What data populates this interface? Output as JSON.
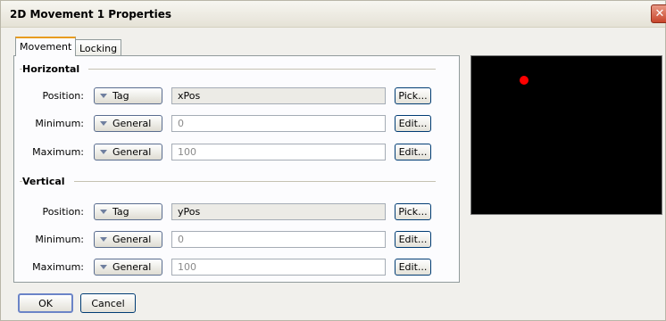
{
  "window": {
    "title": "2D Movement 1 Properties",
    "close_glyph": "✕"
  },
  "tabs": [
    {
      "label": "Movement"
    },
    {
      "label": "Locking"
    }
  ],
  "sections": [
    {
      "label": "Horizontal",
      "rows": [
        {
          "label": "Position:",
          "mode": "Tag",
          "value": "xPos",
          "action": "Pick..."
        },
        {
          "label": "Minimum:",
          "mode": "General",
          "value": "0",
          "action": "Edit..."
        },
        {
          "label": "Maximum:",
          "mode": "General",
          "value": "100",
          "action": "Edit..."
        }
      ]
    },
    {
      "label": "Vertical",
      "rows": [
        {
          "label": "Position:",
          "mode": "Tag",
          "value": "yPos",
          "action": "Pick..."
        },
        {
          "label": "Minimum:",
          "mode": "General",
          "value": "0",
          "action": "Edit..."
        },
        {
          "label": "Maximum:",
          "mode": "General",
          "value": "100",
          "action": "Edit..."
        }
      ]
    }
  ],
  "buttons": {
    "ok": "OK",
    "cancel": "Cancel"
  },
  "colors": {
    "preview_bg": "#000000",
    "dot": "#ff0000",
    "tab_accent": "#e89c1f"
  }
}
